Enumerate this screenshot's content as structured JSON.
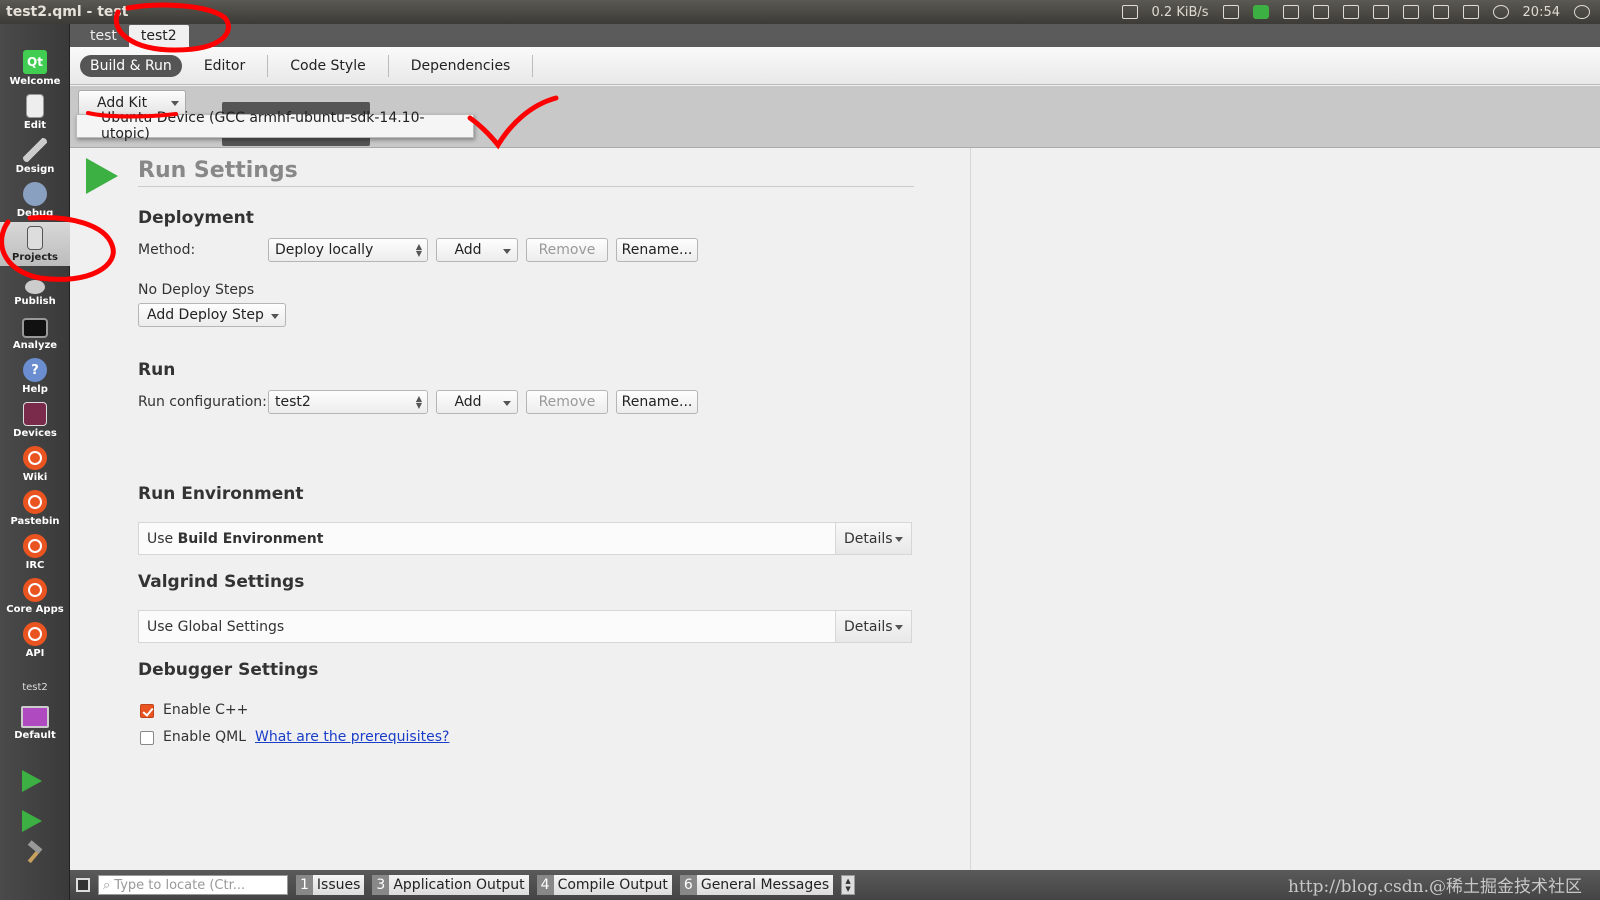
{
  "window": {
    "title": "test2.qml - test"
  },
  "system_tray": {
    "net_speed": "0.2 KiB/s",
    "time": "20:54"
  },
  "project_tabs": [
    "test",
    "test2"
  ],
  "mode_bar": {
    "items": [
      "Welcome",
      "Edit",
      "Design",
      "Debug",
      "Projects",
      "Publish",
      "Analyze",
      "Help",
      "Devices",
      "Wiki",
      "Pastebin",
      "IRC",
      "Core Apps",
      "API"
    ],
    "active": "Projects",
    "kit_project": "test2",
    "kit_build": "Default"
  },
  "settings_tabs": [
    "Build & Run",
    "Editor",
    "Code Style",
    "Dependencies"
  ],
  "kit_bar": {
    "add_kit_label": "Add Kit",
    "dropdown_option": "Ubuntu Device (GCC armhf-ubuntu-sdk-14.10-utopic)"
  },
  "run_settings": {
    "title": "Run Settings",
    "deployment": {
      "heading": "Deployment",
      "method_label": "Method:",
      "method_value": "Deploy locally",
      "add_label": "Add",
      "remove_label": "Remove",
      "rename_label": "Rename...",
      "no_steps_label": "No Deploy Steps",
      "add_step_label": "Add Deploy Step"
    },
    "run": {
      "heading": "Run",
      "config_label": "Run configuration:",
      "config_value": "test2",
      "add_label": "Add",
      "remove_label": "Remove",
      "rename_label": "Rename..."
    },
    "run_environment": {
      "heading": "Run Environment",
      "prefix": "Use ",
      "value": "Build Environment",
      "details_label": "Details"
    },
    "valgrind": {
      "heading": "Valgrind Settings",
      "value": "Use Global Settings",
      "details_label": "Details"
    },
    "debugger": {
      "heading": "Debugger Settings",
      "cpp_label": "Enable C++",
      "cpp_checked": true,
      "qml_label": "Enable QML",
      "qml_checked": false,
      "prereq_link": "What are the prerequisites?"
    }
  },
  "bottom_bar": {
    "locate_placeholder": "Type to locate (Ctr...",
    "panes": [
      {
        "num": "1",
        "label": "Issues"
      },
      {
        "num": "3",
        "label": "Application Output"
      },
      {
        "num": "4",
        "label": "Compile Output"
      },
      {
        "num": "6",
        "label": "General Messages"
      }
    ]
  },
  "watermark": "http://blog.csdn.@稀土掘金技术社区",
  "colors": {
    "accent_green": "#3cb043",
    "ubuntu_orange": "#e95420",
    "annotation_red": "#ff0000",
    "link_blue": "#1a3dc8"
  }
}
